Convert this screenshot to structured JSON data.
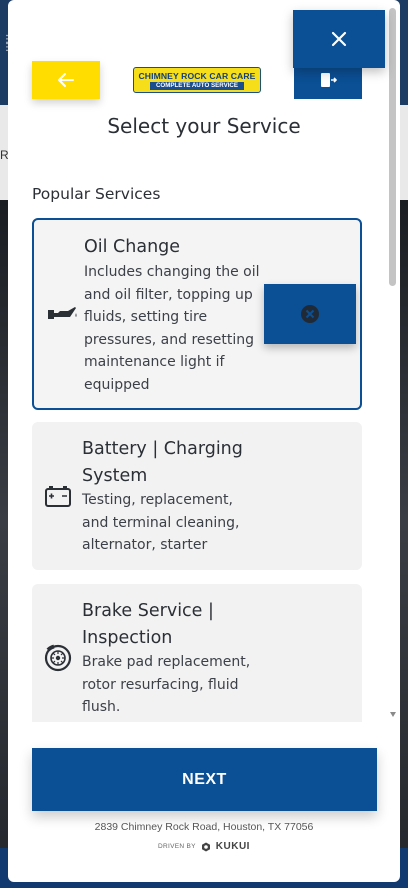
{
  "colors": {
    "primary": "#0b4f94",
    "accent_yellow": "#ffdd00",
    "card_bg": "#f2f2f2",
    "text": "#2b2f36"
  },
  "header": {
    "logo": {
      "line1": "CHIMNEY ROCK CAR CARE",
      "line2": "COMPLETE AUTO SERVICE"
    },
    "back_icon": "arrow-left-icon",
    "close_icon": "close-icon",
    "exit_icon": "exit-door-icon"
  },
  "page_title": "Select your Service",
  "section_title": "Popular Services",
  "services": [
    {
      "name_lines": [
        "Oil Change"
      ],
      "desc_lines": [
        "Includes changing the oil",
        "and oil filter, topping up",
        "fluids, setting tire",
        "pressures, and resetting",
        "maintenance light if",
        "equipped"
      ],
      "icon": "oil-can-icon",
      "selected": true
    },
    {
      "name_lines": [
        "Battery | Charging",
        "System"
      ],
      "desc_lines": [
        "Testing, replacement,",
        "and terminal cleaning,",
        "alternator, starter"
      ],
      "icon": "battery-icon",
      "selected": false
    },
    {
      "name_lines": [
        "Brake Service |",
        "Inspection"
      ],
      "desc_lines": [
        "Brake pad replacement,",
        "rotor resurfacing, fluid",
        "flush."
      ],
      "icon": "brake-disc-icon",
      "selected": false
    }
  ],
  "remove_icon": "remove-circle-icon",
  "next_label": "NEXT",
  "footer": {
    "address": "2839 Chimney Rock Road, Houston, TX 77056",
    "driven_by": "DRIVEN BY",
    "brand": "KUKUI"
  }
}
